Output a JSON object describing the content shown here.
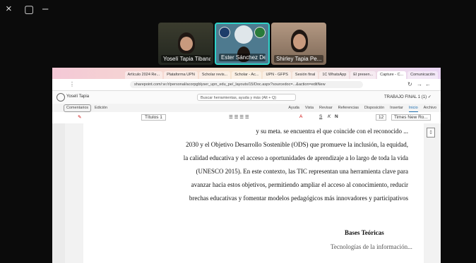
{
  "window_controls": {
    "close": "×",
    "restore": "▢",
    "minimize": "–"
  },
  "participants": [
    {
      "name": "Yoselí Tapia Tibana"
    },
    {
      "name": "Ester Sánchez De la..."
    },
    {
      "name": "Shirley Tapia Pe..."
    }
  ],
  "browser": {
    "tabs": [
      {
        "label": "Comunicación"
      },
      {
        "label": "Capture - C..."
      },
      {
        "label": "El presen..."
      },
      {
        "label": "1C WhatsApp"
      },
      {
        "label": "Sesión final"
      },
      {
        "label": "UPN - GFPS"
      },
      {
        "label": "Scholar - Ac..."
      },
      {
        "label": "Scholar revis..."
      },
      {
        "label": "Plataforma UPN"
      },
      {
        "label": "Artículo 2024 Re..."
      }
    ],
    "url": "sharepoint.com/:w:/r/personal/acorpgblyser_upn_edu_pe/_layouts/15/Doc.aspx?sourcedoc=...&action=editNew"
  },
  "word": {
    "doc_title": "TRABAJO FINAL 1 (1) ✓",
    "search_placeholder": "Buscar herramientas, ayuda y más (Alt + Q)",
    "user": "Yoselí Tapia",
    "ribbon_tabs": [
      "Archivo",
      "Inicio",
      "Insertar",
      "Disposición",
      "Referencias",
      "Revisar",
      "Vista",
      "Ayuda"
    ],
    "active_tab": "Inicio",
    "font_name": "Times New Ro...",
    "font_size": "12",
    "style_label": "Títulos 1",
    "comments_label": "Comentarios",
    "editing_label": "Edición",
    "document_lines": [
      "y su meta. se encuentra el que coincide con el reconocido ...",
      "2030 y el Objetivo Desarrollo Sostenible (ODS) que promueve la inclusión, la equidad,",
      "la calidad educativa y el acceso a oportunidades de aprendizaje a lo largo de toda la vida",
      "(UNESCO 2015). En este contexto, las TIC representan una herramienta clave para",
      "avanzar hacia estos objetivos, permitiendo ampliar el acceso al conocimiento, reducir",
      "brechas educativas y fomentar modelos pedagógicos más innovadores y participativos"
    ],
    "heading": "Bases Teóricas",
    "tail_text": "Tecnologías de la información..."
  }
}
